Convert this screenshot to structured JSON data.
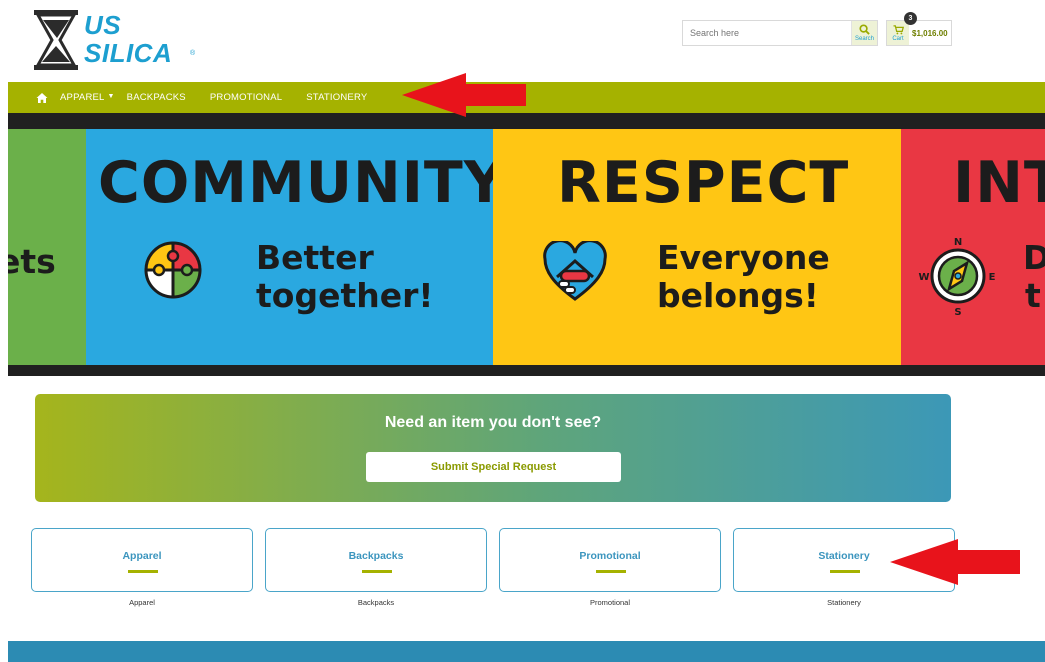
{
  "header": {
    "logo": {
      "line1": "US",
      "line2": "SILICA",
      "reg": "®"
    },
    "search": {
      "placeholder": "Search here",
      "button_label": "Search"
    },
    "cart": {
      "label": "Cart",
      "count": "3",
      "total": "$1,016.00"
    }
  },
  "nav": {
    "items": [
      {
        "label": "APPAREL"
      },
      {
        "label": "BACKPACKS"
      },
      {
        "label": "PROMOTIONAL"
      },
      {
        "label": "STATIONERY"
      }
    ]
  },
  "banner": {
    "left_fragment": [
      "ets",
      "!"
    ],
    "panels": [
      {
        "title": "COMMUNITY",
        "line1": "Better",
        "line2": "together!"
      },
      {
        "title": "RESPECT",
        "line1": "Everyone",
        "line2": "belongs!"
      },
      {
        "title": "INT",
        "line1": "D",
        "line2": "t"
      }
    ],
    "compass": {
      "n": "N",
      "s": "S",
      "e": "E",
      "w": "W"
    }
  },
  "request": {
    "title": "Need an item you don't see?",
    "button_label": "Submit Special Request"
  },
  "categories": [
    {
      "title": "Apparel",
      "caption": "Apparel"
    },
    {
      "title": "Backpacks",
      "caption": "Backpacks"
    },
    {
      "title": "Promotional",
      "caption": "Promotional"
    },
    {
      "title": "Stationery",
      "caption": "Stationery"
    }
  ],
  "colors": {
    "brand_blue": "#1d9fd0",
    "nav_green": "#a5b200",
    "panel_blue": "#2aa8e0",
    "panel_yellow": "#ffc614",
    "panel_red": "#e93743",
    "panel_green": "#6bb04a",
    "annotation_red": "#e8131b"
  }
}
